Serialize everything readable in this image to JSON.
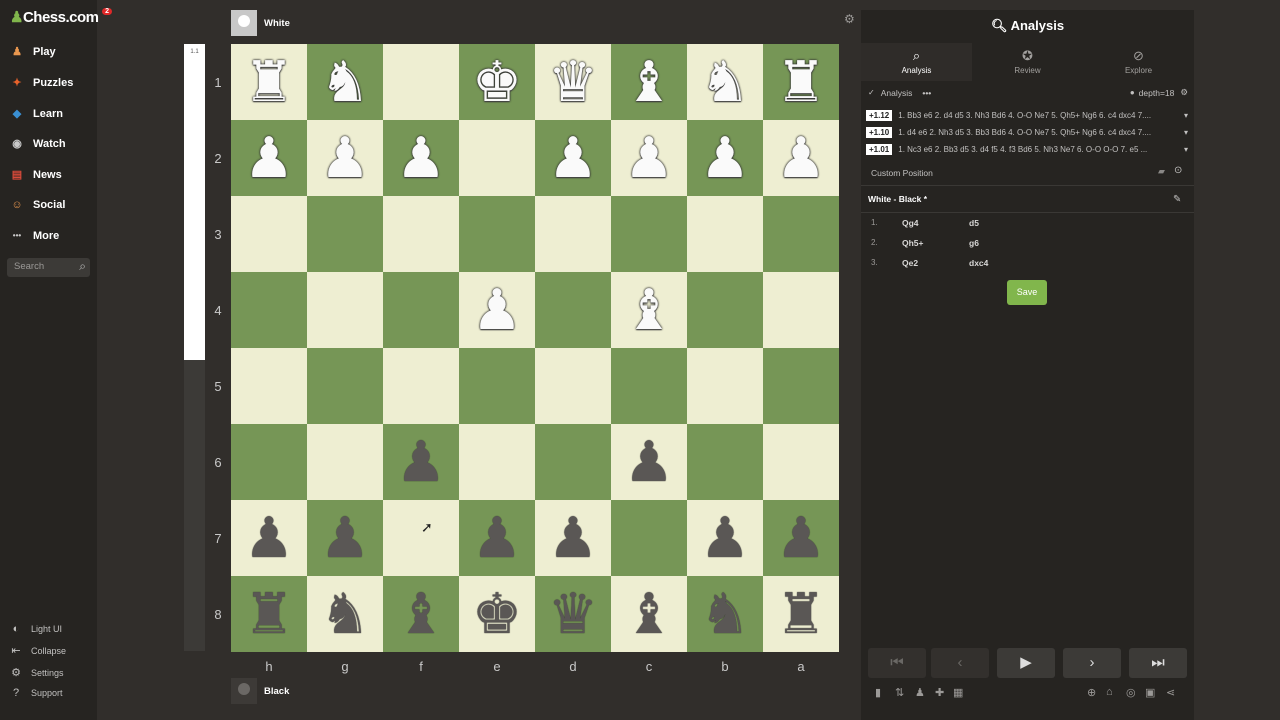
{
  "sidebar": {
    "logo": "Chess.com",
    "badge": "2",
    "nav": [
      {
        "label": "Play",
        "icon": "play-icon",
        "color": "#e8974f"
      },
      {
        "label": "Puzzles",
        "icon": "puzzle-icon",
        "color": "#e8622b"
      },
      {
        "label": "Learn",
        "icon": "learn-icon",
        "color": "#3a8fd2"
      },
      {
        "label": "Watch",
        "icon": "watch-icon",
        "color": "#c9c9c9"
      },
      {
        "label": "News",
        "icon": "news-icon",
        "color": "#d84a3a"
      },
      {
        "label": "Social",
        "icon": "social-icon",
        "color": "#e8974f"
      },
      {
        "label": "More",
        "icon": "more-icon",
        "color": "#c9c9c9"
      }
    ],
    "search_placeholder": "Search",
    "bottom": [
      "Light UI",
      "Collapse",
      "Settings",
      "Support"
    ]
  },
  "game": {
    "top_player": "White",
    "bottom_player": "Black",
    "eval_label": "1.1",
    "eval_white_fraction": 0.52,
    "ranks": [
      "1",
      "2",
      "3",
      "4",
      "5",
      "6",
      "7",
      "8"
    ],
    "files": [
      "h",
      "g",
      "f",
      "e",
      "d",
      "c",
      "b",
      "a"
    ],
    "board": [
      [
        "wR",
        "wN",
        "",
        "wK",
        "wQ",
        "wB",
        "wN",
        "wR"
      ],
      [
        "wP",
        "wP",
        "wP",
        "",
        "wP",
        "wP",
        "wP",
        "wP"
      ],
      [
        "",
        "",
        "",
        "",
        "",
        "",
        "",
        ""
      ],
      [
        "",
        "",
        "",
        "wP",
        "",
        "wB",
        "",
        ""
      ],
      [
        "",
        "",
        "",
        "",
        "",
        "",
        "",
        ""
      ],
      [
        "",
        "",
        "bP",
        "",
        "",
        "bP",
        "",
        ""
      ],
      [
        "bP",
        "bP",
        "",
        "bP",
        "bP",
        "",
        "bP",
        "bP"
      ],
      [
        "bR",
        "bN",
        "bB",
        "bK",
        "bQ",
        "bB",
        "bN",
        "bR"
      ]
    ]
  },
  "panel": {
    "title": "Analysis",
    "tabs": [
      "Analysis",
      "Review",
      "Explore"
    ],
    "analysis_toggle": "Analysis",
    "depth": "depth=18",
    "lines": [
      {
        "eval": "+1.12",
        "text": "1. Bb3 e6 2. d4 d5 3. Nh3 Bd6 4. O-O Ne7 5. Qh5+ Ng6 6. c4 dxc4 7...."
      },
      {
        "eval": "+1.10",
        "text": "1. d4 e6 2. Nh3 d5 3. Bb3 Bd6 4. O-O Ne7 5. Qh5+ Ng6 6. c4 dxc4 7...."
      },
      {
        "eval": "+1.01",
        "text": "1. Nc3 e6 2. Bb3 d5 3. d4 f5 4. f3 Bd6 5. Nh3 Ne7 6. O-O O-O 7. e5 ..."
      }
    ],
    "custom_position": "Custom Position",
    "players": "White - Black *",
    "moves": [
      {
        "n": "1.",
        "w": "Qg4",
        "b": "d5"
      },
      {
        "n": "2.",
        "w": "Qh5+",
        "b": "g6"
      },
      {
        "n": "3.",
        "w": "Qe2",
        "b": "dxc4"
      }
    ],
    "save_label": "Save"
  }
}
